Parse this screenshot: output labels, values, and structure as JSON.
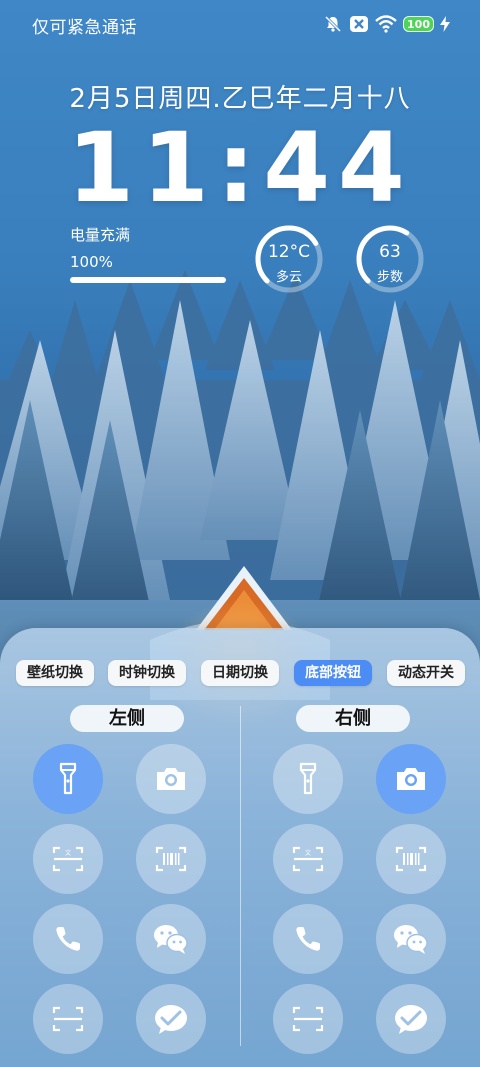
{
  "status_bar": {
    "carrier_text": "仅可紧急通话",
    "battery_level": "100",
    "icons": [
      "mute-bell-icon",
      "no-sim-icon",
      "wifi-icon",
      "battery-icon",
      "charging-bolt-icon"
    ]
  },
  "lock_screen": {
    "date": "2月5日周四.乙巳年二月十八",
    "time": "11:44"
  },
  "battery_widget": {
    "label": "电量充满",
    "percent_text": "100%",
    "level": 1.0
  },
  "weather_widget": {
    "temperature": "12°C",
    "condition": "多云",
    "ring_fraction": 0.72
  },
  "steps_widget": {
    "value": "63",
    "label": "步数",
    "ring_fraction": 0.62
  },
  "panel": {
    "tabs": [
      {
        "label": "壁纸切换",
        "active": false
      },
      {
        "label": "时钟切换",
        "active": false
      },
      {
        "label": "日期切换",
        "active": false
      },
      {
        "label": "底部按钮",
        "active": true
      },
      {
        "label": "动态开关",
        "active": false
      }
    ],
    "left_label": "左侧",
    "right_label": "右侧",
    "left_buttons": [
      "flashlight-icon",
      "camera-icon",
      "scan-text-icon",
      "barcode-icon",
      "phone-icon",
      "wechat-icon",
      "scan-icon",
      "check-app-icon"
    ],
    "right_buttons": [
      "flashlight-icon",
      "camera-icon",
      "scan-text-icon",
      "barcode-icon",
      "phone-icon",
      "wechat-icon",
      "scan-icon",
      "check-app-icon"
    ],
    "left_selected": "flashlight-icon",
    "right_selected": "camera-icon",
    "accent_color": "#4c8cf5"
  }
}
